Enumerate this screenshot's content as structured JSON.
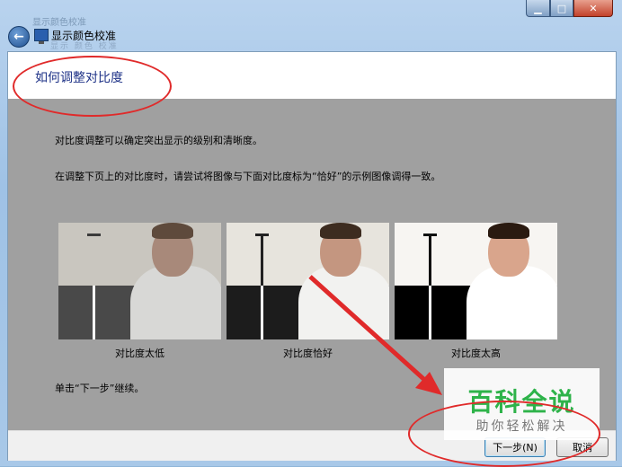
{
  "window": {
    "blurred_caption": "显示颜色校准",
    "app_title": "显示颜色校准",
    "blurred_breadcrumb": "显示  颜色  校准",
    "caption_buttons": {
      "minimize": "▁",
      "maximize": "□",
      "close": "✕"
    }
  },
  "page": {
    "title": "如何调整对比度",
    "paragraph1": "对比度调整可以确定突出显示的级别和清晰度。",
    "paragraph2": "在调整下页上的对比度时，请尝试将图像与下面对比度标为“恰好”的示例图像调得一致。",
    "samples": [
      {
        "caption": "对比度太低"
      },
      {
        "caption": "对比度恰好"
      },
      {
        "caption": "对比度太高"
      }
    ],
    "continue_hint": "单击“下一步”继续。"
  },
  "footer": {
    "next_label": "下一步(N)",
    "cancel_label": "取消"
  },
  "watermark": {
    "title": "百科全说",
    "subtitle": "助你轻松解决"
  },
  "colors": {
    "title_blue": "#1e3287",
    "annotation_red": "#e02a2a",
    "watermark_green": "#2eb34a",
    "content_gray": "#a0a0a0"
  }
}
